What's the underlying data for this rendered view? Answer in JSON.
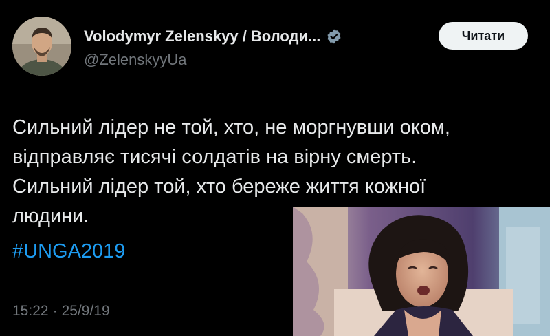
{
  "author": {
    "display_name": "Volodymyr Zelenskyy / Володи...",
    "handle": "@ZelenskyyUa",
    "verified": true,
    "verified_icon": "verified-badge-icon",
    "avatar_icon": "profile-avatar"
  },
  "follow_button": {
    "label": "Читати"
  },
  "tweet": {
    "lines": [
      "Сильний лідер не той, хто, не моргнувши оком,",
      "відправляє тисячі солдатів на вірну смерть.",
      "Сильний лідер той, хто береже життя кожної",
      "людини."
    ],
    "hashtag": "#UNGA2019",
    "time": "15:22",
    "separator": "·",
    "date": "25/9/19"
  },
  "colors": {
    "background": "#000000",
    "text": "#e7e9ea",
    "muted": "#71767b",
    "link": "#1d9bf0",
    "button_bg": "#eff3f4",
    "verified_badge": "#829aab"
  },
  "overlay_image": {
    "description_icon": "reaction-photo"
  }
}
